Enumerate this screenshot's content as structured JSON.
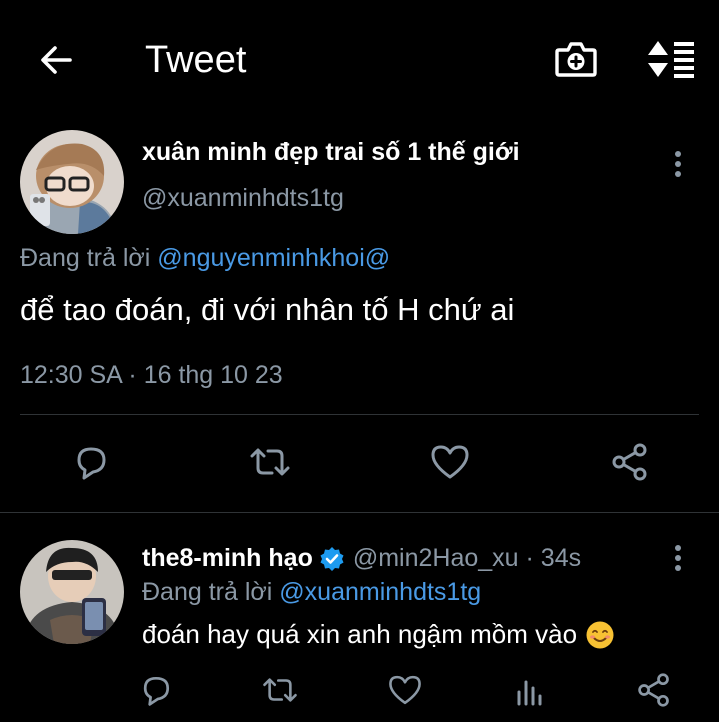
{
  "header": {
    "title": "Tweet",
    "back_icon": "arrow-left-icon",
    "camera_icon": "camera-add-icon",
    "sort_icon": "sort-icon"
  },
  "main_tweet": {
    "author_name": "xuân minh đẹp trai số 1 thế giới",
    "author_handle": "@xuanminhdts1tg",
    "replying_prefix": "Đang trả lời",
    "replying_to": "@nguyenminhkhoi@",
    "text": "để tao đoán, đi với nhân tố H chứ ai",
    "timestamp": "12:30 SA · 16 thg 10 23",
    "actions": [
      "reply-icon",
      "retweet-icon",
      "like-icon",
      "share-icon"
    ]
  },
  "reply_tweet": {
    "author_name": "the8-minh hạo",
    "verified": true,
    "author_handle": "@min2Hao_xu · 34s",
    "replying_prefix": "Đang trả lời",
    "replying_to": "@xuanminhdts1tg",
    "text": "đoán hay quá xin anh ngậm mồm vào",
    "emoji": "smiling-face-emoji",
    "actions": [
      "reply-icon",
      "retweet-icon",
      "like-icon",
      "analytics-icon",
      "share-icon"
    ]
  },
  "colors": {
    "background": "#000000",
    "primary_text": "#ffffff",
    "secondary_text": "#8b98a5",
    "link": "#4a9ae5",
    "verified_badge": "#1d9bf0",
    "divider": "#2f3336"
  }
}
